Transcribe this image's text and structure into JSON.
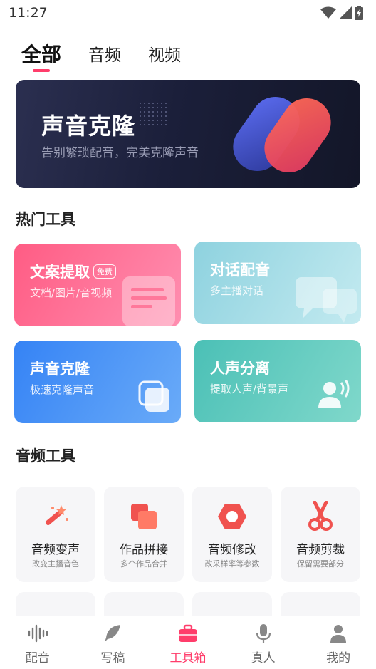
{
  "status_bar": {
    "time": "11:27"
  },
  "top_tabs": [
    {
      "label": "全部",
      "active": true
    },
    {
      "label": "音频",
      "active": false
    },
    {
      "label": "视频",
      "active": false
    }
  ],
  "banner": {
    "title": "声音克隆",
    "subtitle": "告别繁琐配音，完美克隆声音"
  },
  "hot_section": {
    "title": "热门工具"
  },
  "hot_tools": [
    {
      "title": "文案提取",
      "badge": "免费",
      "subtitle": "文档/图片/音视频",
      "color_from": "#ff5e86",
      "color_to": "#ff8fb0"
    },
    {
      "title": "对话配音",
      "subtitle": "多主播对话",
      "color_from": "#8fd3df",
      "color_to": "#bfe9ef"
    },
    {
      "title": "声音克隆",
      "subtitle": "极速克隆声音",
      "color_from": "#3a86f5",
      "color_to": "#64a7f7"
    },
    {
      "title": "人声分离",
      "subtitle": "提取人声/背景声",
      "color_from": "#4ec2b8",
      "color_to": "#7fd8cb"
    }
  ],
  "audio_section": {
    "title": "音频工具"
  },
  "audio_tools": [
    {
      "name": "音频变声",
      "desc": "改变主播音色",
      "icon": "magic-wand-icon"
    },
    {
      "name": "作品拼接",
      "desc": "多个作品合并",
      "icon": "merge-squares-icon"
    },
    {
      "name": "音频修改",
      "desc": "改采样率等参数",
      "icon": "hexagon-settings-icon"
    },
    {
      "name": "音频剪裁",
      "desc": "保留需要部分",
      "icon": "scissors-icon"
    }
  ],
  "bottom_nav": [
    {
      "label": "配音",
      "icon": "waveform-icon",
      "active": false
    },
    {
      "label": "写稿",
      "icon": "feather-icon",
      "active": false
    },
    {
      "label": "工具箱",
      "icon": "toolbox-icon",
      "active": true
    },
    {
      "label": "真人",
      "icon": "microphone-icon",
      "active": false
    },
    {
      "label": "我的",
      "icon": "person-icon",
      "active": false
    }
  ],
  "colors": {
    "accent": "#ff3d6b",
    "icon_red": "#f0524f"
  }
}
